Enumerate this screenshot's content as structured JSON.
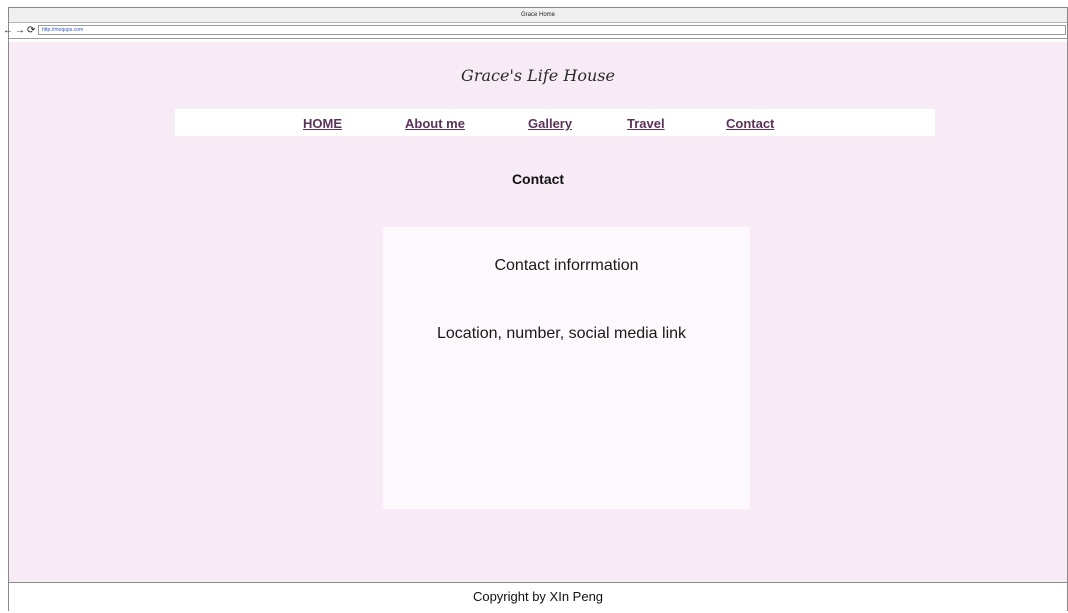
{
  "window": {
    "title": "Grace Home",
    "url": "http://moqups.com"
  },
  "site": {
    "title": "Grace's Life House"
  },
  "nav": {
    "items": [
      {
        "label": "HOME"
      },
      {
        "label": "About me"
      },
      {
        "label": "Gallery"
      },
      {
        "label": "Travel"
      },
      {
        "label": "Contact"
      }
    ]
  },
  "main": {
    "heading": "Contact",
    "card": {
      "title": "Contact inforrmation",
      "body": "Location, number, social media link"
    }
  },
  "footer": {
    "text": "Copyright by XIn Peng"
  },
  "colors": {
    "page_background": "#f7ebf5",
    "card_background": "#fcf8fb",
    "nav_link": "#5a3358"
  },
  "icons": {
    "back": "arrow-left-icon",
    "forward": "arrow-right-icon",
    "reload": "reload-icon"
  }
}
